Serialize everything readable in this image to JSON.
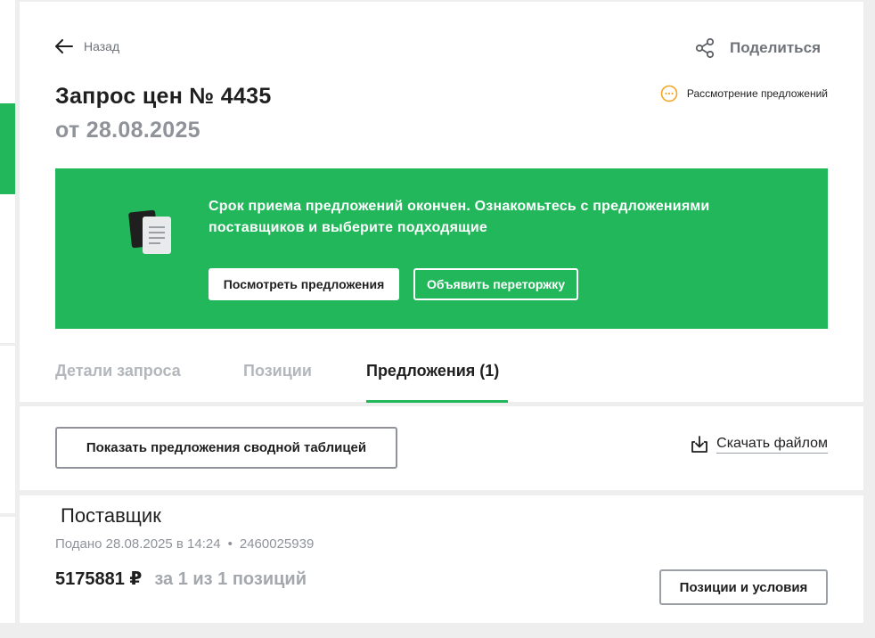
{
  "header": {
    "back_label": "Назад",
    "share_label": "Поделиться"
  },
  "request": {
    "title": "Запрос цен № 4435",
    "date": "от 28.08.2025",
    "status": "Рассмотрение предложений"
  },
  "banner": {
    "text": "Срок приема предложений окончен. Ознакомьтесь с предложениями поставщиков и выберите подходящие",
    "view_button": "Посмотреть предложения",
    "rebid_button": "Объявить переторжку"
  },
  "tabs": [
    {
      "label": "Детали запроса",
      "active": false
    },
    {
      "label": "Позиции",
      "active": false
    },
    {
      "label": "Предложения (1)",
      "active": true
    }
  ],
  "toolbar": {
    "summary_button": "Показать предложения сводной таблицей",
    "download_label": "Скачать файлом"
  },
  "offer": {
    "supplier": "Поставщик",
    "submitted": "Подано 28.08.2025 в 14:24",
    "separator": "•",
    "inn": "2460025939",
    "price": "5175881 ₽",
    "price_note": "за 1 из 1 позиций",
    "positions_button": "Позиции и условия"
  },
  "colors": {
    "accent_green": "#22b75b",
    "status_orange": "#f5a623",
    "muted_text": "#8f9399"
  }
}
